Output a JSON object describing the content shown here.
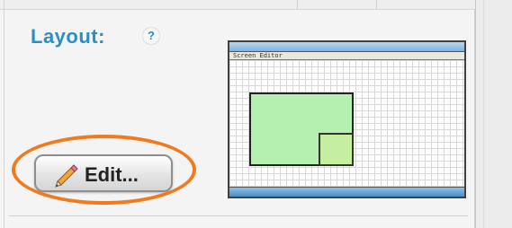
{
  "layout_section": {
    "title": "Layout:",
    "help_symbol": "?"
  },
  "edit_button": {
    "label": "Edit...",
    "icon": "pencil-icon"
  },
  "preview": {
    "menubar_text": "Screen Editor"
  },
  "colors": {
    "accent": "#2a8fc4",
    "highlight": "#f07b1e",
    "region_fill": "#b6f0b0"
  }
}
